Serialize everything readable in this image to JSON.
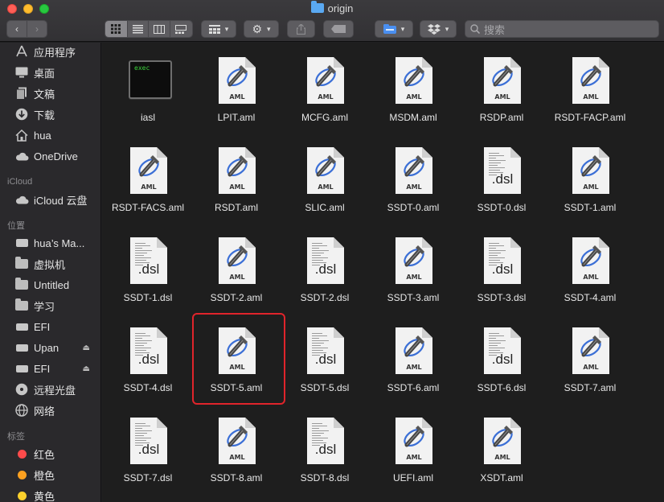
{
  "window": {
    "title": "origin"
  },
  "toolbar": {
    "search_placeholder": "搜索",
    "back_icon": "chevron-left-icon",
    "forward_icon": "chevron-right-icon"
  },
  "sidebar": {
    "favorites": [
      {
        "label": "应用程序",
        "icon": "applications-icon"
      },
      {
        "label": "桌面",
        "icon": "desktop-icon"
      },
      {
        "label": "文稿",
        "icon": "documents-icon"
      },
      {
        "label": "下载",
        "icon": "downloads-icon"
      },
      {
        "label": "hua",
        "icon": "home-icon"
      },
      {
        "label": "OneDrive",
        "icon": "cloud-icon"
      }
    ],
    "icloud_header": "iCloud",
    "icloud": [
      {
        "label": "iCloud 云盘",
        "icon": "icloud-icon"
      }
    ],
    "locations_header": "位置",
    "locations": [
      {
        "label": "hua’s Ma...",
        "icon": "laptop-icon",
        "eject": false
      },
      {
        "label": "虚拟机",
        "icon": "folder-icon",
        "eject": false
      },
      {
        "label": "Untitled",
        "icon": "folder-icon",
        "eject": false
      },
      {
        "label": "学习",
        "icon": "folder-icon",
        "eject": false
      },
      {
        "label": "EFI",
        "icon": "drive-icon",
        "eject": false
      },
      {
        "label": "Upan",
        "icon": "drive-icon",
        "eject": true
      },
      {
        "label": "EFI",
        "icon": "drive-icon",
        "eject": true
      },
      {
        "label": "远程光盘",
        "icon": "disc-icon",
        "eject": false
      },
      {
        "label": "网络",
        "icon": "network-icon",
        "eject": false
      }
    ],
    "tags_header": "标签",
    "tags": [
      {
        "label": "红色",
        "color": "#fe4b4b"
      },
      {
        "label": "橙色",
        "color": "#fda120"
      },
      {
        "label": "黄色",
        "color": "#fbd02c"
      }
    ]
  },
  "files": [
    {
      "name": "iasl",
      "kind": "exec",
      "exec_label": "exec"
    },
    {
      "name": "LPIT.aml",
      "kind": "aml"
    },
    {
      "name": "MCFG.aml",
      "kind": "aml"
    },
    {
      "name": "MSDM.aml",
      "kind": "aml"
    },
    {
      "name": "RSDP.aml",
      "kind": "aml"
    },
    {
      "name": "RSDT-FACP.aml",
      "kind": "aml"
    },
    {
      "name": "RSDT-FACS.aml",
      "kind": "aml"
    },
    {
      "name": "RSDT.aml",
      "kind": "aml"
    },
    {
      "name": "SLIC.aml",
      "kind": "aml"
    },
    {
      "name": "SSDT-0.aml",
      "kind": "aml"
    },
    {
      "name": "SSDT-0.dsl",
      "kind": "dsl"
    },
    {
      "name": "SSDT-1.aml",
      "kind": "aml"
    },
    {
      "name": "SSDT-1.dsl",
      "kind": "dsl"
    },
    {
      "name": "SSDT-2.aml",
      "kind": "aml"
    },
    {
      "name": "SSDT-2.dsl",
      "kind": "dsl"
    },
    {
      "name": "SSDT-3.aml",
      "kind": "aml"
    },
    {
      "name": "SSDT-3.dsl",
      "kind": "dsl"
    },
    {
      "name": "SSDT-4.aml",
      "kind": "aml"
    },
    {
      "name": "SSDT-4.dsl",
      "kind": "dsl"
    },
    {
      "name": "SSDT-5.aml",
      "kind": "aml",
      "selected": true
    },
    {
      "name": "SSDT-5.dsl",
      "kind": "dsl"
    },
    {
      "name": "SSDT-6.aml",
      "kind": "aml"
    },
    {
      "name": "SSDT-6.dsl",
      "kind": "dsl"
    },
    {
      "name": "SSDT-7.aml",
      "kind": "aml"
    },
    {
      "name": "SSDT-7.dsl",
      "kind": "dsl"
    },
    {
      "name": "SSDT-8.aml",
      "kind": "aml"
    },
    {
      "name": "SSDT-8.dsl",
      "kind": "dsl"
    },
    {
      "name": "UEFI.aml",
      "kind": "aml"
    },
    {
      "name": "XSDT.aml",
      "kind": "aml"
    }
  ],
  "labels": {
    "aml_badge": "AML",
    "dsl_badge": ".dsl"
  },
  "colors": {
    "accent": "#5aa9f2",
    "selection_outline": "#e0242b"
  }
}
